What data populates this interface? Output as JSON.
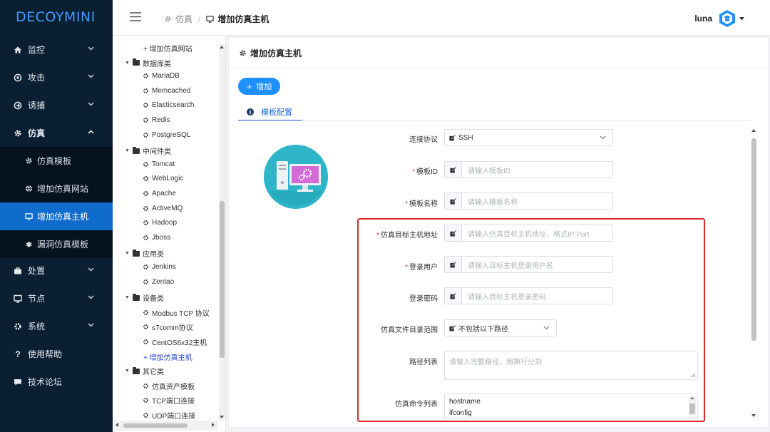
{
  "app": {
    "logo_text": "DECOYMINI",
    "brand_color": "#1e90ff"
  },
  "header": {
    "breadcrumb": {
      "parent": "仿真",
      "current": "增加仿真主机"
    },
    "user": "luna"
  },
  "sidebar": {
    "items": [
      {
        "label": "监控",
        "icon": "home-icon"
      },
      {
        "label": "攻击",
        "icon": "target-icon"
      },
      {
        "label": "诱捕",
        "icon": "trap-icon"
      },
      {
        "label": "仿真",
        "icon": "gear-icon",
        "expanded": true
      },
      {
        "label": "处置",
        "icon": "toolbox-icon"
      },
      {
        "label": "节点",
        "icon": "monitor-icon"
      },
      {
        "label": "系统",
        "icon": "settings-icon"
      },
      {
        "label": "使用帮助",
        "icon": "question-icon"
      },
      {
        "label": "技术论坛",
        "icon": "chat-icon"
      }
    ],
    "sub_items": [
      {
        "label": "仿真模板",
        "icon": "gear-icon"
      },
      {
        "label": "增加仿真网站",
        "icon": "globe-icon"
      },
      {
        "label": "增加仿真主机",
        "icon": "monitor-icon",
        "active": true
      },
      {
        "label": "漏洞仿真模板",
        "icon": "bug-icon"
      }
    ]
  },
  "tree": {
    "add_site": "+ 增加仿真网站",
    "groups": [
      {
        "label": "数据库类",
        "items": [
          "MariaDB",
          "Memcached",
          "Elasticsearch",
          "Redis",
          "PostgreSQL"
        ]
      },
      {
        "label": "中间件类",
        "items": [
          "Tomcat",
          "WebLogic",
          "Apache",
          "ActiveMQ",
          "Hadoop",
          "Jboss"
        ]
      },
      {
        "label": "应用类",
        "items": [
          "Jenkins",
          "Zentao"
        ]
      },
      {
        "label": "设备类",
        "items": [
          "Modbus TCP 协议",
          "s7comm协议",
          "CentOS6x32主机"
        ]
      },
      {
        "label": "其它类",
        "items": [
          "仿真资产模板",
          "TCP端口连接",
          "UDP端口连接"
        ]
      }
    ],
    "add_host": "+ 增加仿真主机"
  },
  "card": {
    "title": "增加仿真主机",
    "add_button": "增加",
    "tab": "模板配置"
  },
  "form": {
    "protocol": {
      "label": "连接协议",
      "value": "SSH"
    },
    "template_id": {
      "label": "模板ID",
      "placeholder": "请输入模板ID"
    },
    "template_name": {
      "label": "模板名称",
      "placeholder": "请输入模板名称"
    },
    "target_addr": {
      "label": "仿真目标主机地址",
      "placeholder": "请输入仿真目标主机地址，格式IP:Port"
    },
    "login_user": {
      "label": "登录用户",
      "placeholder": "请输入目标主机登录用户名"
    },
    "login_pass": {
      "label": "登录密码",
      "placeholder": "请输入目标主机登录密码"
    },
    "dir_scope": {
      "label": "仿真文件目录范围",
      "value": "不包括以下路径"
    },
    "path_list": {
      "label": "路径列表",
      "placeholder": "请输入完整路径，用换行分割"
    },
    "cmd_list": {
      "label": "仿真命令列表",
      "lines": [
        "hostname",
        "ifconfig"
      ]
    }
  }
}
